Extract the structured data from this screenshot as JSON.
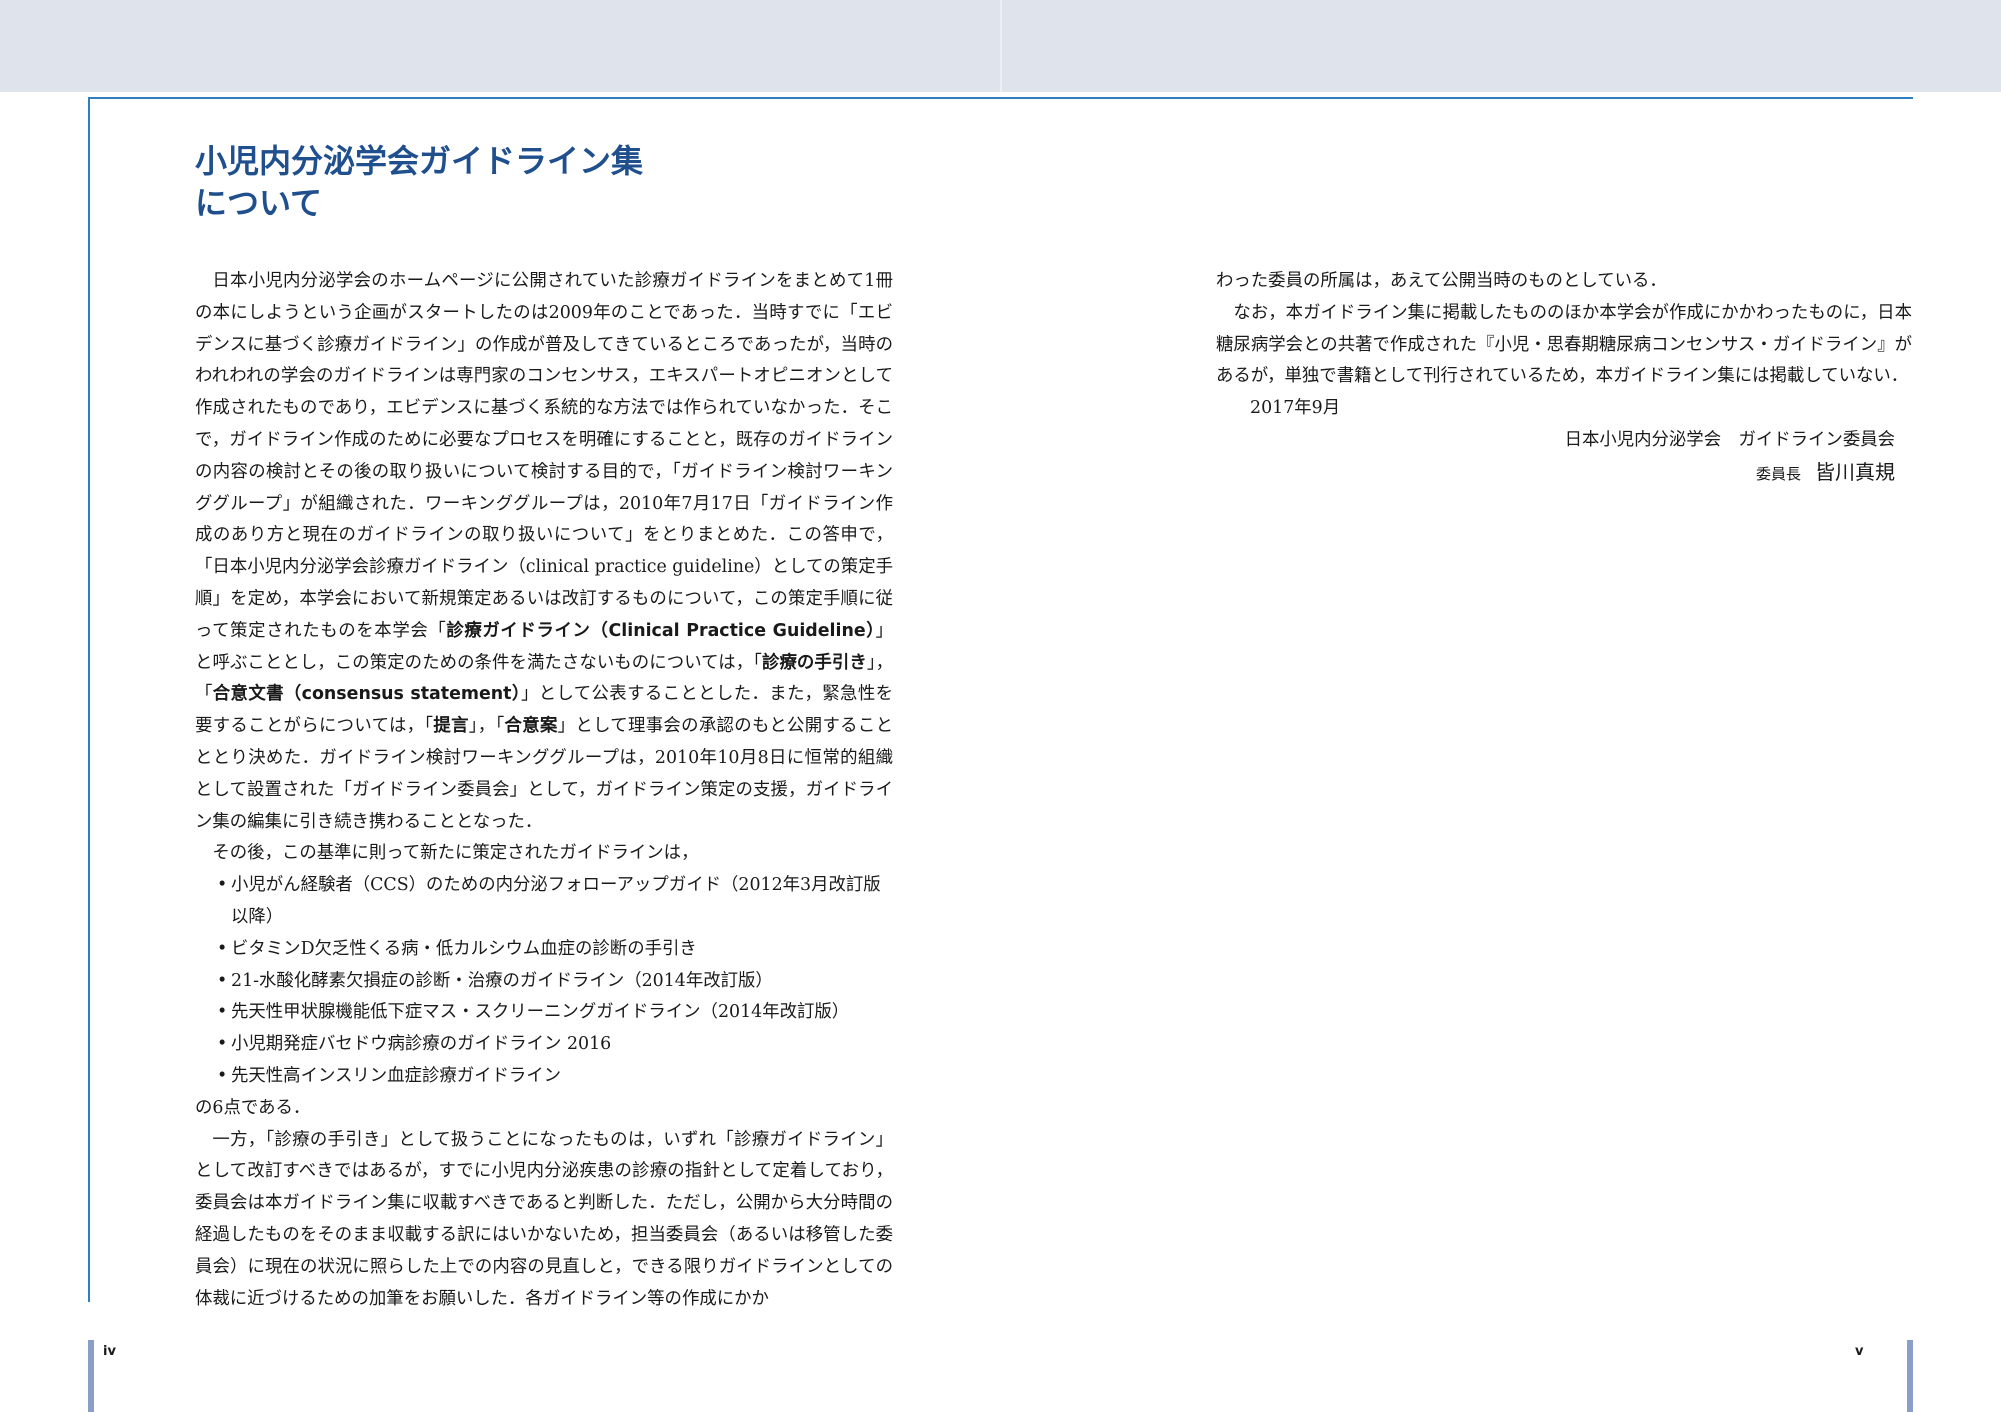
{
  "title": {
    "line1": "小児内分泌学会ガイドライン集",
    "line2": "について"
  },
  "left_column": {
    "p1": "日本小児内分泌学会のホームページに公開されていた診療ガイドラインをまとめて1冊の本にしようという企画がスタートしたのは2009年のことであった．当時すでに「エビデンスに基づく診療ガイドライン」の作成が普及してきているところであったが，当時のわれわれの学会のガイドラインは専門家のコンセンサス，エキスパートオピニオンとして作成されたものであり，エビデンスに基づく系統的な方法では作られていなかった．そこで，ガイドライン作成のために必要なプロセスを明確にすることと，既存のガイドラインの内容の検討とその後の取り扱いについて検討する目的で，「ガイドライン検討ワーキンググループ」が組織された．ワーキンググループは，2010年7月17日「ガイドライン作成のあり方と現在のガイドラインの取り扱いについて」をとりまとめた．この答申で，「日本小児内分泌学会診療ガイドライン（clinical practice guideline）としての策定手順」を定め，本学会において新規策定あるいは改訂するものについて，この策定手順に従って策定されたものを本学会「",
    "p1_bold1": "診療ガイドライン（Clinical Practice Guideline）",
    "p1_b": "」と呼ぶこととし，この策定のための条件を満たさないものについては，「",
    "p1_bold2": "診療の手引き",
    "p1_c": "」，「",
    "p1_bold3": "合意文書（consensus statement）",
    "p1_d": "」として公表することとした．また，緊急性を要することがらについては，「",
    "p1_bold4": "提言",
    "p1_e": "」，「",
    "p1_bold5": "合意案",
    "p1_f": "」として理事会の承認のもと公開することととり決めた．ガイドライン検討ワーキンググループは，2010年10月8日に恒常的組織として設置された「ガイドライン委員会」として，ガイドライン策定の支援，ガイドライン集の編集に引き続き携わることとなった．",
    "p2": "その後，この基準に則って新たに策定されたガイドラインは，",
    "bullets": [
      "小児がん経験者（CCS）のための内分泌フォローアップガイド（2012年3月改訂版以降）",
      "ビタミンD欠乏性くる病・低カルシウム血症の診断の手引き",
      "21-水酸化酵素欠損症の診断・治療のガイドライン（2014年改訂版）",
      "先天性甲状腺機能低下症マス・スクリーニングガイドライン（2014年改訂版）",
      "小児期発症バセドウ病診療のガイドライン 2016",
      "先天性高インスリン血症診療ガイドライン"
    ],
    "bullet_mark": "•",
    "p3": "の6点である．",
    "p4": "一方，「診療の手引き」として扱うことになったものは，いずれ「診療ガイドライン」として改訂すべきではあるが，すでに小児内分泌疾患の診療の指針として定着しており，委員会は本ガイドライン集に収載すべきであると判断した．ただし，公開から大分時間の経過したものをそのまま収載する訳にはいかないため，担当委員会（あるいは移管した委員会）に現在の状況に照らした上での内容の見直しと，できる限りガイドラインとしての体裁に近づけるための加筆をお願いした．各ガイドライン等の作成にかか"
  },
  "right_column": {
    "p1": "わった委員の所属は，あえて公開当時のものとしている．",
    "p2": "なお，本ガイドライン集に掲載したもののほか本学会が作成にかかわったものに，日本糖尿病学会との共著で作成された『小児・思春期糖尿病コンセンサス・ガイドライン』があるが，単独で書籍として刊行されているため，本ガイドライン集には掲載していない．",
    "date": "2017年9月",
    "org": "日本小児内分泌学会　ガイドライン委員会",
    "role": "委員長",
    "name": "皆川真規"
  },
  "page_numbers": {
    "left": "iv",
    "right": "v"
  },
  "colors": {
    "title": "#1f4f8c",
    "rule": "#2e7fc0",
    "top_band": "#dfe3ec",
    "tab": "#8a9ec8"
  }
}
